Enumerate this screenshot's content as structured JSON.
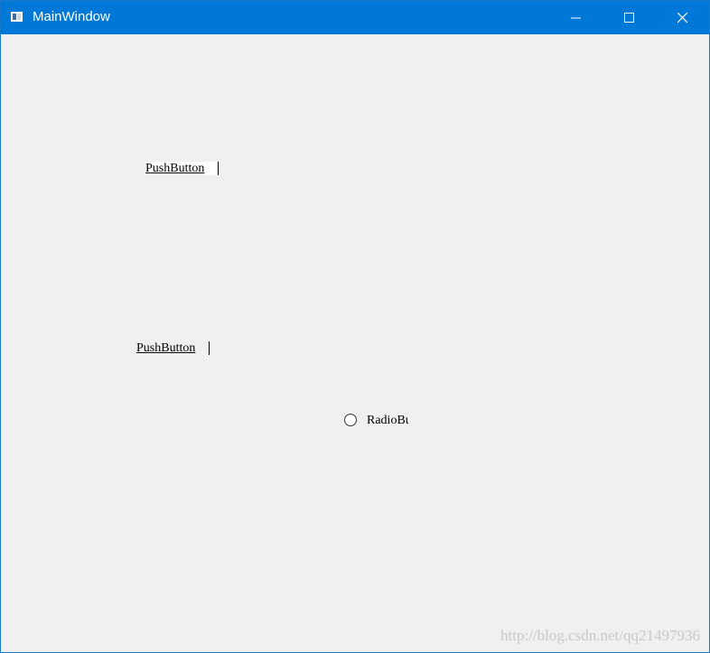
{
  "window": {
    "title": "MainWindow",
    "app_icon": "window-icon",
    "controls": {
      "minimize": "minimize-icon",
      "maximize": "maximize-icon",
      "close": "close-icon"
    },
    "titlebar_color": "#0078d7",
    "client_color": "#f0f0f0"
  },
  "widgets": {
    "push_button_1": "PushButton",
    "push_button_2": "PushButton",
    "radio_button": "RadioButton"
  },
  "watermark": "http://blog.csdn.net/qq21497936"
}
